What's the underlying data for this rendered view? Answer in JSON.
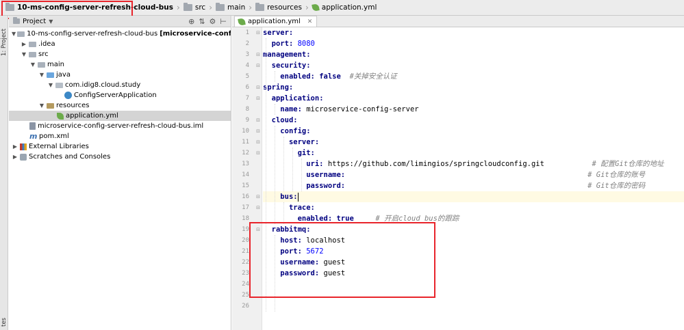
{
  "navbar": {
    "crumbs": [
      {
        "label": "10-ms-config-server-refresh-cloud-bus"
      },
      {
        "label": "src"
      },
      {
        "label": "main"
      },
      {
        "label": "resources"
      },
      {
        "label": "application.yml"
      }
    ]
  },
  "leftstrip": {
    "project_tab": "1: Project",
    "bottom_tab": "tes"
  },
  "project_panel": {
    "title": "Project",
    "tree": [
      {
        "name": "10-ms-config-server-refresh-cloud-bus",
        "extra": "[microservice-config-server-refres"
      },
      {
        "name": ".idea"
      },
      {
        "name": "src"
      },
      {
        "name": "main"
      },
      {
        "name": "java"
      },
      {
        "name": "com.idig8.cloud.study"
      },
      {
        "name": "ConfigServerApplication"
      },
      {
        "name": "resources"
      },
      {
        "name": "application.yml"
      },
      {
        "name": "microservice-config-server-refresh-cloud-bus.iml"
      },
      {
        "name": "pom.xml"
      },
      {
        "name": "External Libraries"
      },
      {
        "name": "Scratches and Consoles"
      }
    ]
  },
  "editor": {
    "tab_label": "application.yml",
    "line_numbers": [
      "1",
      "2",
      "3",
      "4",
      "5",
      "6",
      "7",
      "8",
      "9",
      "10",
      "11",
      "12",
      "13",
      "14",
      "15",
      "16",
      "17",
      "18",
      "19",
      "20",
      "21",
      "22",
      "23",
      "24",
      "25",
      "26"
    ],
    "code": {
      "l1_key": "server:",
      "l2_key": "port:",
      "l2_val": "8080",
      "l3_key": "management:",
      "l4_key": "security:",
      "l5_key": "enabled:",
      "l5_val": "false",
      "l5_comment": "#关掉安全认证",
      "l6_key": "spring:",
      "l7_key": "application:",
      "l8_key": "name:",
      "l8_val": "microservice-config-server",
      "l9_key": "cloud:",
      "l10_key": "config:",
      "l11_key": "server:",
      "l12_key": "git:",
      "l13_key": "uri:",
      "l13_val": "https://github.com/limingios/springcloudconfig.git",
      "l13_comment": "# 配置Git仓库的地址",
      "l14_key": "username:",
      "l14_comment": "# Git仓库的账号",
      "l15_key": "password:",
      "l15_comment": "# Git仓库的密码",
      "l16_key": "bus:",
      "l17_key": "trace:",
      "l18_key": "enabled:",
      "l18_val": "true",
      "l18_comment": "# 开启cloud bus的跟踪",
      "l19_key": "rabbitmq:",
      "l20_key": "host:",
      "l20_val": "localhost",
      "l21_key": "port:",
      "l21_val": "5672",
      "l22_key": "username:",
      "l22_val": "guest",
      "l23_key": "password:",
      "l23_val": "guest"
    }
  },
  "colors": {
    "annotation_red": "#e8232a",
    "yaml_key": "#000080",
    "number": "#0000ff",
    "comment": "#808080",
    "current_line": "#fffae3"
  }
}
